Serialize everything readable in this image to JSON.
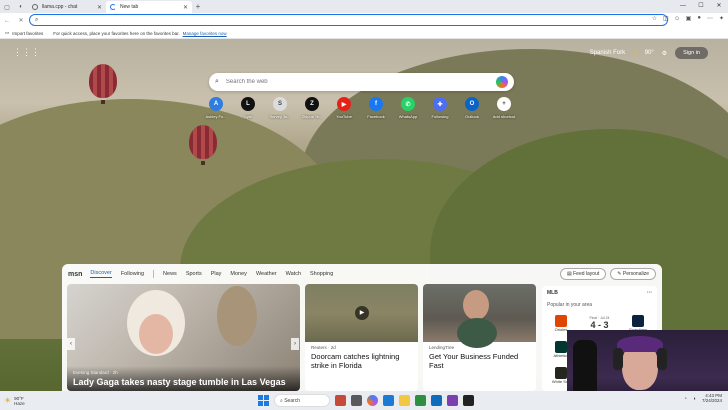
{
  "tabs": [
    {
      "title": "llama.cpp - chat",
      "active": false
    },
    {
      "title": "New tab",
      "active": true
    }
  ],
  "window_controls": [
    "—",
    "☐",
    "✕"
  ],
  "address_bar": {
    "value": "",
    "placeholder": ""
  },
  "favorites_bar": {
    "import": "Import favorites",
    "message": "For quick access, place your favorites here on the favorites bar.",
    "link": "Manage favorites now"
  },
  "header": {
    "location": "Spanish Fork",
    "temperature": "90°",
    "sign_in": "Sign in"
  },
  "search": {
    "placeholder": "Search the web"
  },
  "quick_links": [
    {
      "label": "Ashley Fu...",
      "color": "#2f7de1",
      "glyph": "A"
    },
    {
      "label": "Lyst",
      "color": "#111111",
      "glyph": "L"
    },
    {
      "label": "Survey Ju...",
      "color": "#dcdcdc",
      "glyph": "S"
    },
    {
      "label": "Zhipus Te...",
      "color": "#111111",
      "glyph": "Z"
    },
    {
      "label": "YouTube",
      "color": "#e62117",
      "glyph": "▶"
    },
    {
      "label": "Facebook",
      "color": "#1877f2",
      "glyph": "f"
    },
    {
      "label": "WhatsApp",
      "color": "#25d366",
      "glyph": "✆"
    },
    {
      "label": "Following",
      "color": "#4c6ef5",
      "glyph": "✚"
    },
    {
      "label": "Outlook",
      "color": "#0a64c8",
      "glyph": "O"
    },
    {
      "label": "Add shortcut",
      "color": "#ffffff",
      "glyph": "+"
    }
  ],
  "feed": {
    "logo": "msn",
    "nav": [
      "Discover",
      "Following",
      "News",
      "Sports",
      "Play",
      "Money",
      "Weather",
      "Watch",
      "Shopping"
    ],
    "buttons": [
      "Feed layout",
      "Personalize"
    ],
    "cards": [
      {
        "source": "Evening Standard · 2h",
        "headline": "Lady Gaga takes nasty stage tumble in Las Vegas"
      },
      {
        "source": "Reuters · 2d",
        "headline": "Doorcam catches lightning strike in Florida"
      },
      {
        "source": "LendingTree",
        "headline": "Get Your Business Funded Fast"
      }
    ],
    "scores": {
      "league": "MLB",
      "more": "···",
      "subtitle": "Popular in your area",
      "games": [
        {
          "home": "Orioles",
          "away": "Guardians",
          "score": "4 - 3",
          "time": "Final · Jul 24",
          "home_color": "#df4601",
          "away_color": "#0c2340"
        },
        {
          "home": "Athletics",
          "away": "Astros",
          "score": "1 - 2",
          "time": "Final · Jul 24",
          "home_color": "#003831",
          "away_color": "#002d62"
        },
        {
          "home": "White Sox",
          "away": "",
          "score": "",
          "time": "",
          "home_color": "#27251f",
          "away_color": "#ffffff"
        }
      ]
    }
  },
  "taskbar": {
    "weather_temp": "90°F",
    "weather_desc": "Haze",
    "search": "Search",
    "clock_time": "4:43 PM",
    "clock_date": "7/24/2024"
  }
}
